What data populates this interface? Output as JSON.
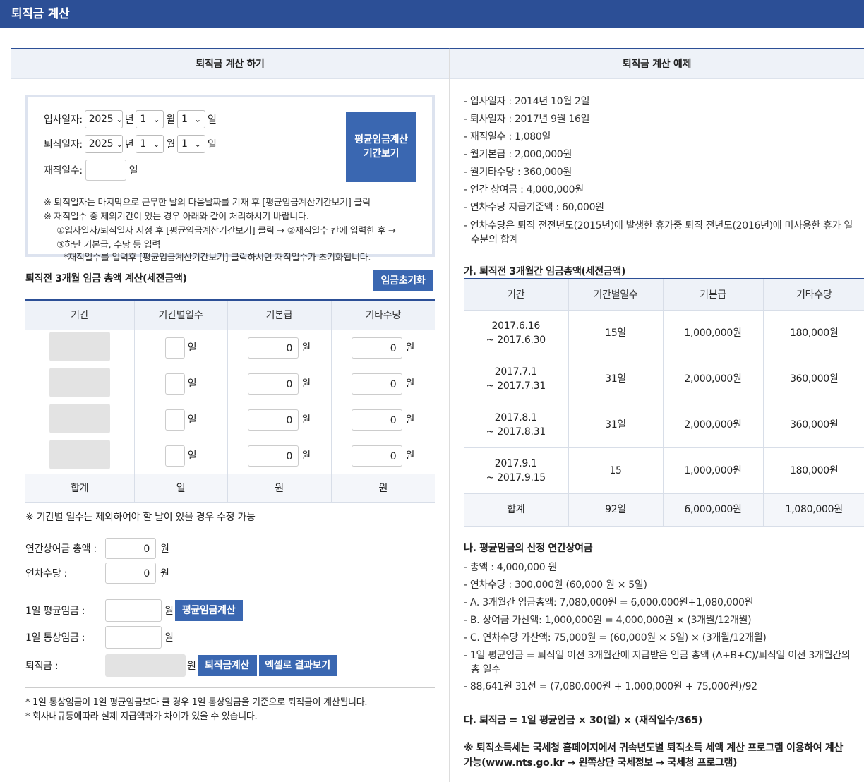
{
  "app_title": "퇴직금 계산",
  "left": {
    "header": "퇴직금 계산 하기",
    "form": {
      "start_label": "입사일자:",
      "end_label": "퇴직일자:",
      "days_label": "재직일수:",
      "year_value": "2025",
      "month_value": "1",
      "day_value": "1",
      "year_unit": "년",
      "month_unit": "월",
      "day_unit": "일",
      "days_unit": "일",
      "period_button": "평균임금계산\n기간보기"
    },
    "notes": [
      "※ 퇴직일자는 마지막으로 근무한 날의 다음날짜를 기재 후 [평균임금계산기간보기] 클릭",
      "※ 재직일수 중 제외기간이 있는 경우 아래와 같이 처리하시기 바랍니다.",
      "①입사일자/퇴직일자 지정 후 [평균임금계산기간보기] 클릭 → ②재직일수 칸에 입력한 후 →",
      "③하단 기본급, 수당 등 입력",
      "*재직일수를 입력후 [평균임금계산기간보기] 클릭하시면 재직일수가 초기화됩니다."
    ],
    "section_title": "퇴직전 3개월 임금 총액 계산(세전금액)",
    "reset_button": "임금초기화",
    "table_headers": [
      "기간",
      "기간별일수",
      "기본급",
      "기타수당"
    ],
    "rows": [
      {
        "base": "0",
        "other": "0"
      },
      {
        "base": "0",
        "other": "0"
      },
      {
        "base": "0",
        "other": "0"
      },
      {
        "base": "0",
        "other": "0"
      }
    ],
    "unit_day": "일",
    "unit_won": "원",
    "sum_label": "합계",
    "days_note": "※ 기간별 일수는 제외하여야 할 날이 있을 경우 수정 가능",
    "bonus_label": "연간상여금 총액 :",
    "bonus_value": "0",
    "annual_label": "연차수당 :",
    "annual_value": "0",
    "avg_label": "1일 평균임금 :",
    "avg_button": "평균임금계산",
    "ordinary_label": "1일 통상임금 :",
    "severance_label": "퇴직금 :",
    "calc_button": "퇴직금계산",
    "excel_button": "엑셀로 결과보기",
    "footer_notes": [
      "* 1일 통상임금이 1일 평균임금보다 클 경우 1일 통상임금을 기준으로 퇴직금이 계산됩니다.",
      "* 회사내규등에따라 실제 지급액과가 차이가 있을 수 있습니다."
    ]
  },
  "right": {
    "header": "퇴직금 계산 예제",
    "info": [
      "- 입사일자 : 2014년 10월 2일",
      "- 퇴사일자 : 2017년 9월 16일",
      "- 재직일수 : 1,080일",
      "- 월기본급 : 2,000,000원",
      "- 월기타수당 : 360,000원",
      "- 연간 상여금 : 4,000,000원",
      "- 연차수당 지급기준액 : 60,000원",
      "- 연차수당은 퇴직 전전년도(2015년)에 발생한 휴가중 퇴직 전년도(2016년)에 미사용한 휴가 일수분의 합계"
    ],
    "section_a": "가. 퇴직전 3개월간 임금총액(세전금액)",
    "ex_headers": [
      "기간",
      "기간별일수",
      "기본급",
      "기타수당"
    ],
    "ex_rows": [
      {
        "p1": "2017.6.16",
        "p2": "~ 2017.6.30",
        "days": "15일",
        "base": "1,000,000원",
        "other": "180,000원"
      },
      {
        "p1": "2017.7.1",
        "p2": "~ 2017.7.31",
        "days": "31일",
        "base": "2,000,000원",
        "other": "360,000원"
      },
      {
        "p1": "2017.8.1",
        "p2": "~ 2017.8.31",
        "days": "31일",
        "base": "2,000,000원",
        "other": "360,000원"
      },
      {
        "p1": "2017.9.1",
        "p2": "~ 2017.9.15",
        "days": "15",
        "base": "1,000,000원",
        "other": "180,000원"
      }
    ],
    "ex_sum": {
      "label": "합계",
      "days": "92일",
      "base": "6,000,000원",
      "other": "1,080,000원"
    },
    "section_b": "나. 평균임금의 산정 연간상여금",
    "b_items": [
      "- 총액 : 4,000,000 원",
      "- 연차수당 : 300,000원 (60,000 원 × 5일)",
      "- A. 3개월간 임금총액: 7,080,000원 = 6,000,000원+1,080,000원",
      "- B. 상여금 가산액: 1,000,000원 = 4,000,000원 × (3개월/12개월)",
      "- C. 연차수당 가산액: 75,000원 = (60,000원 × 5일) × (3개월/12개월)",
      "- 1일 평균임금 = 퇴직일 이전 3개월간에 지급받은 임금 총액 (A+B+C)/퇴직일 이전 3개월간의 총 일수",
      "- 88,641원 31전 = (7,080,000원 + 1,000,000원 + 75,000원)/92"
    ],
    "section_c": "다. 퇴직금 = 1일 평균임금 × 30(일) × (재직일수/365)",
    "tax_note": "※ 퇴직소득세는 국세청 홈페이지에서 귀속년도별 퇴직소득 세액 계산 프로그램 이용하여 계산 가능(www.nts.go.kr → 왼쪽상단 국세정보 → 국세청 프로그램)"
  }
}
